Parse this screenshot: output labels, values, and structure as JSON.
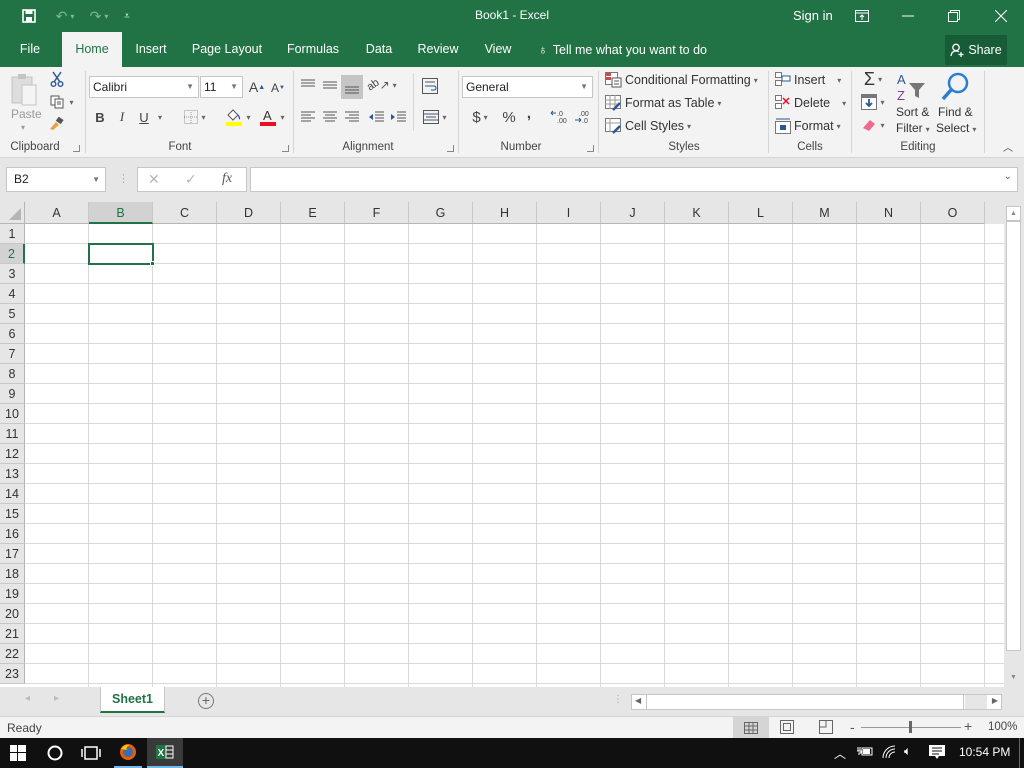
{
  "app": {
    "title": "Book1 - Excel",
    "sign_in": "Sign in",
    "share": "Share"
  },
  "tabs": [
    {
      "label": "File"
    },
    {
      "label": "Home",
      "active": true
    },
    {
      "label": "Insert"
    },
    {
      "label": "Page Layout"
    },
    {
      "label": "Formulas"
    },
    {
      "label": "Data"
    },
    {
      "label": "Review"
    },
    {
      "label": "View"
    }
  ],
  "tell_me": "Tell me what you want to do",
  "ribbon": {
    "clipboard": {
      "label": "Clipboard",
      "paste": "Paste"
    },
    "font": {
      "label": "Font",
      "name": "Calibri",
      "size": "11",
      "bold": "B",
      "italic": "I",
      "underline": "U",
      "fill_color": "#ffff00",
      "font_color": "#e81123"
    },
    "alignment": {
      "label": "Alignment"
    },
    "number": {
      "label": "Number",
      "format": "General",
      "currency": "$",
      "percent": "%",
      "comma": ","
    },
    "styles": {
      "label": "Styles",
      "conditional": "Conditional Formatting",
      "format_table": "Format as Table",
      "cell_styles": "Cell Styles"
    },
    "cells": {
      "label": "Cells",
      "insert": "Insert",
      "delete": "Delete",
      "format": "Format"
    },
    "editing": {
      "label": "Editing",
      "sort_filter_1": "Sort &",
      "sort_filter_2": "Filter",
      "find_select_1": "Find &",
      "find_select_2": "Select"
    }
  },
  "formula_bar": {
    "name_box": "B2",
    "formula": "",
    "fx": "fx"
  },
  "grid": {
    "columns": [
      "A",
      "B",
      "C",
      "D",
      "E",
      "F",
      "G",
      "H",
      "I",
      "J",
      "K",
      "L",
      "M",
      "N",
      "O"
    ],
    "rows": [
      "1",
      "2",
      "3",
      "4",
      "5",
      "6",
      "7",
      "8",
      "9",
      "10",
      "11",
      "12",
      "13",
      "14",
      "15",
      "16",
      "17",
      "18",
      "19",
      "20",
      "21",
      "22",
      "23"
    ],
    "selected_cell": "B2",
    "selected_col": "B",
    "selected_row": "2"
  },
  "sheets": [
    {
      "label": "Sheet1",
      "active": true
    }
  ],
  "status": {
    "text": "Ready",
    "zoom": "100%"
  },
  "taskbar": {
    "time": "10:54 PM"
  },
  "colors": {
    "excel_green": "#217346",
    "share_green": "#185c37"
  }
}
